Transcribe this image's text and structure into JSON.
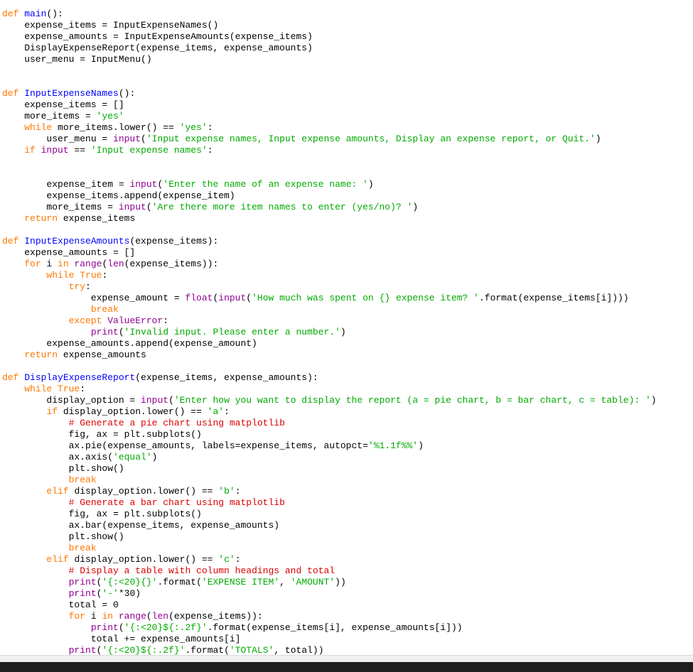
{
  "editor": {
    "colors": {
      "keyword": "#ff7700",
      "string": "#00aa00",
      "definition": "#0000ff",
      "builtin": "#900090",
      "comment": "#dd0000",
      "text": "#000000",
      "background": "#ffffff"
    },
    "lines": [
      [
        [
          "kw",
          "def "
        ],
        [
          "fn",
          "main"
        ],
        [
          "pl",
          "():"
        ]
      ],
      [
        [
          "pl",
          "    expense_items = InputExpenseNames()"
        ]
      ],
      [
        [
          "pl",
          "    expense_amounts = InputExpenseAmounts(expense_items)"
        ]
      ],
      [
        [
          "pl",
          "    DisplayExpenseReport(expense_items, expense_amounts)"
        ]
      ],
      [
        [
          "pl",
          "    user_menu = InputMenu()"
        ]
      ],
      [],
      [],
      [
        [
          "kw",
          "def "
        ],
        [
          "fn",
          "InputExpenseNames"
        ],
        [
          "pl",
          "():"
        ]
      ],
      [
        [
          "pl",
          "    expense_items = []"
        ]
      ],
      [
        [
          "pl",
          "    more_items = "
        ],
        [
          "str",
          "'yes'"
        ]
      ],
      [
        [
          "pl",
          "    "
        ],
        [
          "kw",
          "while"
        ],
        [
          "pl",
          " more_items.lower() == "
        ],
        [
          "str",
          "'yes'"
        ],
        [
          "pl",
          ":"
        ]
      ],
      [
        [
          "pl",
          "        user_menu = "
        ],
        [
          "bi",
          "input"
        ],
        [
          "pl",
          "("
        ],
        [
          "str",
          "'Input expense names, Input expense amounts, Display an expense report, or Quit.'"
        ],
        [
          "pl",
          ")"
        ]
      ],
      [
        [
          "pl",
          "    "
        ],
        [
          "kw",
          "if "
        ],
        [
          "bi",
          "input"
        ],
        [
          "pl",
          " == "
        ],
        [
          "str",
          "'Input expense names'"
        ],
        [
          "pl",
          ":"
        ]
      ],
      [],
      [],
      [
        [
          "pl",
          "        expense_item = "
        ],
        [
          "bi",
          "input"
        ],
        [
          "pl",
          "("
        ],
        [
          "str",
          "'Enter the name of an expense name: '"
        ],
        [
          "pl",
          ")"
        ]
      ],
      [
        [
          "pl",
          "        expense_items.append(expense_item)"
        ]
      ],
      [
        [
          "pl",
          "        more_items = "
        ],
        [
          "bi",
          "input"
        ],
        [
          "pl",
          "("
        ],
        [
          "str",
          "'Are there more item names to enter (yes/no)? '"
        ],
        [
          "pl",
          ")"
        ]
      ],
      [
        [
          "pl",
          "    "
        ],
        [
          "kw",
          "return"
        ],
        [
          "pl",
          " expense_items"
        ]
      ],
      [],
      [
        [
          "kw",
          "def "
        ],
        [
          "fn",
          "InputExpenseAmounts"
        ],
        [
          "pl",
          "(expense_items):"
        ]
      ],
      [
        [
          "pl",
          "    expense_amounts = []"
        ]
      ],
      [
        [
          "pl",
          "    "
        ],
        [
          "kw",
          "for"
        ],
        [
          "pl",
          " i "
        ],
        [
          "kw",
          "in"
        ],
        [
          "pl",
          " "
        ],
        [
          "bi",
          "range"
        ],
        [
          "pl",
          "("
        ],
        [
          "bi",
          "len"
        ],
        [
          "pl",
          "(expense_items)):"
        ]
      ],
      [
        [
          "pl",
          "        "
        ],
        [
          "kw",
          "while"
        ],
        [
          "pl",
          " "
        ],
        [
          "kw",
          "True"
        ],
        [
          "pl",
          ":"
        ]
      ],
      [
        [
          "pl",
          "            "
        ],
        [
          "kw",
          "try"
        ],
        [
          "pl",
          ":"
        ]
      ],
      [
        [
          "pl",
          "                expense_amount = "
        ],
        [
          "bi",
          "float"
        ],
        [
          "pl",
          "("
        ],
        [
          "bi",
          "input"
        ],
        [
          "pl",
          "("
        ],
        [
          "str",
          "'How much was spent on {} expense item? '"
        ],
        [
          "pl",
          ".format(expense_items[i])))"
        ]
      ],
      [
        [
          "pl",
          "                "
        ],
        [
          "kw",
          "break"
        ]
      ],
      [
        [
          "pl",
          "            "
        ],
        [
          "kw",
          "except"
        ],
        [
          "pl",
          " "
        ],
        [
          "bi",
          "ValueError"
        ],
        [
          "pl",
          ":"
        ]
      ],
      [
        [
          "pl",
          "                "
        ],
        [
          "bi",
          "print"
        ],
        [
          "pl",
          "("
        ],
        [
          "str",
          "'Invalid input. Please enter a number.'"
        ],
        [
          "pl",
          ")"
        ]
      ],
      [
        [
          "pl",
          "        expense_amounts.append(expense_amount)"
        ]
      ],
      [
        [
          "pl",
          "    "
        ],
        [
          "kw",
          "return"
        ],
        [
          "pl",
          " expense_amounts"
        ]
      ],
      [],
      [
        [
          "kw",
          "def "
        ],
        [
          "fn",
          "DisplayExpenseReport"
        ],
        [
          "pl",
          "(expense_items, expense_amounts):"
        ]
      ],
      [
        [
          "pl",
          "    "
        ],
        [
          "kw",
          "while"
        ],
        [
          "pl",
          " "
        ],
        [
          "kw",
          "True"
        ],
        [
          "pl",
          ":"
        ]
      ],
      [
        [
          "pl",
          "        display_option = "
        ],
        [
          "bi",
          "input"
        ],
        [
          "pl",
          "("
        ],
        [
          "str",
          "'Enter how you want to display the report (a = pie chart, b = bar chart, c = table): '"
        ],
        [
          "pl",
          ")"
        ]
      ],
      [
        [
          "pl",
          "        "
        ],
        [
          "kw",
          "if"
        ],
        [
          "pl",
          " display_option.lower() == "
        ],
        [
          "str",
          "'a'"
        ],
        [
          "pl",
          ":"
        ]
      ],
      [
        [
          "pl",
          "            "
        ],
        [
          "cmt",
          "# Generate a pie chart using matplotlib"
        ]
      ],
      [
        [
          "pl",
          "            fig, ax = plt.subplots()"
        ]
      ],
      [
        [
          "pl",
          "            ax.pie(expense_amounts, labels=expense_items, autopct="
        ],
        [
          "str",
          "'%1.1f%%'"
        ],
        [
          "pl",
          ")"
        ]
      ],
      [
        [
          "pl",
          "            ax.axis("
        ],
        [
          "str",
          "'equal'"
        ],
        [
          "pl",
          ")"
        ]
      ],
      [
        [
          "pl",
          "            plt.show()"
        ]
      ],
      [
        [
          "pl",
          "            "
        ],
        [
          "kw",
          "break"
        ]
      ],
      [
        [
          "pl",
          "        "
        ],
        [
          "kw",
          "elif"
        ],
        [
          "pl",
          " display_option.lower() == "
        ],
        [
          "str",
          "'b'"
        ],
        [
          "pl",
          ":"
        ]
      ],
      [
        [
          "pl",
          "            "
        ],
        [
          "cmt",
          "# Generate a bar chart using matplotlib"
        ]
      ],
      [
        [
          "pl",
          "            fig, ax = plt.subplots()"
        ]
      ],
      [
        [
          "pl",
          "            ax.bar(expense_items, expense_amounts)"
        ]
      ],
      [
        [
          "pl",
          "            plt.show()"
        ]
      ],
      [
        [
          "pl",
          "            "
        ],
        [
          "kw",
          "break"
        ]
      ],
      [
        [
          "pl",
          "        "
        ],
        [
          "kw",
          "elif"
        ],
        [
          "pl",
          " display_option.lower() == "
        ],
        [
          "str",
          "'c'"
        ],
        [
          "pl",
          ":"
        ]
      ],
      [
        [
          "pl",
          "            "
        ],
        [
          "cmt",
          "# Display a table with column headings and total"
        ]
      ],
      [
        [
          "pl",
          "            "
        ],
        [
          "bi",
          "print"
        ],
        [
          "pl",
          "("
        ],
        [
          "str",
          "'{:<20}{}'"
        ],
        [
          "pl",
          ".format("
        ],
        [
          "str",
          "'EXPENSE ITEM'"
        ],
        [
          "pl",
          ", "
        ],
        [
          "str",
          "'AMOUNT'"
        ],
        [
          "pl",
          "))"
        ]
      ],
      [
        [
          "pl",
          "            "
        ],
        [
          "bi",
          "print"
        ],
        [
          "pl",
          "("
        ],
        [
          "str",
          "'-'"
        ],
        [
          "pl",
          "*30)"
        ]
      ],
      [
        [
          "pl",
          "            total = 0"
        ]
      ],
      [
        [
          "pl",
          "            "
        ],
        [
          "kw",
          "for"
        ],
        [
          "pl",
          " i "
        ],
        [
          "kw",
          "in"
        ],
        [
          "pl",
          " "
        ],
        [
          "bi",
          "range"
        ],
        [
          "pl",
          "("
        ],
        [
          "bi",
          "len"
        ],
        [
          "pl",
          "(expense_items)):"
        ]
      ],
      [
        [
          "pl",
          "                "
        ],
        [
          "bi",
          "print"
        ],
        [
          "pl",
          "("
        ],
        [
          "str",
          "'{:<20}${:.2f}'"
        ],
        [
          "pl",
          ".format(expense_items[i], expense_amounts[i]))"
        ]
      ],
      [
        [
          "pl",
          "                total += expense_amounts[i]"
        ]
      ],
      [
        [
          "pl",
          "            "
        ],
        [
          "bi",
          "print"
        ],
        [
          "pl",
          "("
        ],
        [
          "str",
          "'{:<20}${:.2f}'"
        ],
        [
          "pl",
          ".format("
        ],
        [
          "str",
          "'TOTALS'"
        ],
        [
          "pl",
          ", total))"
        ]
      ]
    ]
  }
}
